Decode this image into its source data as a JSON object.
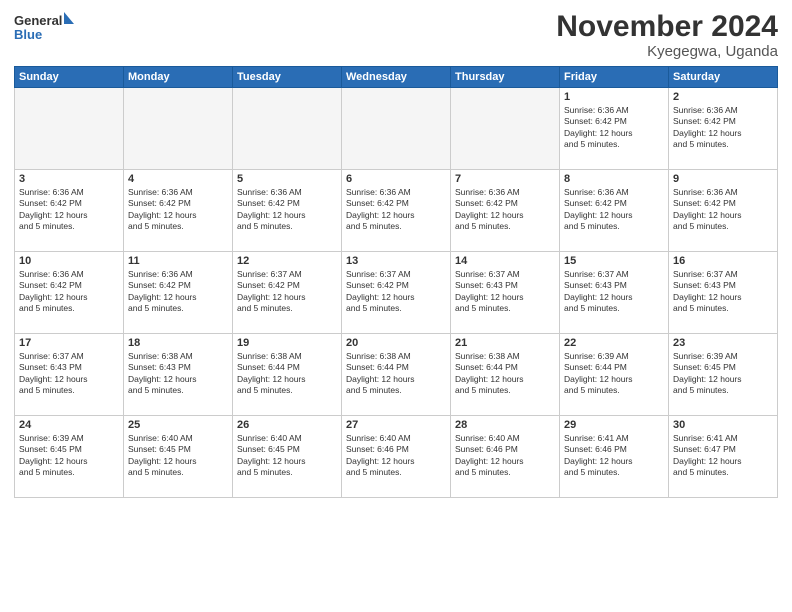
{
  "logo": {
    "general": "General",
    "blue": "Blue"
  },
  "title": "November 2024",
  "subtitle": "Kyegegwa, Uganda",
  "days_of_week": [
    "Sunday",
    "Monday",
    "Tuesday",
    "Wednesday",
    "Thursday",
    "Friday",
    "Saturday"
  ],
  "weeks": [
    [
      {
        "day": "",
        "info": ""
      },
      {
        "day": "",
        "info": ""
      },
      {
        "day": "",
        "info": ""
      },
      {
        "day": "",
        "info": ""
      },
      {
        "day": "",
        "info": ""
      },
      {
        "day": "1",
        "info": "Sunrise: 6:36 AM\nSunset: 6:42 PM\nDaylight: 12 hours\nand 5 minutes."
      },
      {
        "day": "2",
        "info": "Sunrise: 6:36 AM\nSunset: 6:42 PM\nDaylight: 12 hours\nand 5 minutes."
      }
    ],
    [
      {
        "day": "3",
        "info": "Sunrise: 6:36 AM\nSunset: 6:42 PM\nDaylight: 12 hours\nand 5 minutes."
      },
      {
        "day": "4",
        "info": "Sunrise: 6:36 AM\nSunset: 6:42 PM\nDaylight: 12 hours\nand 5 minutes."
      },
      {
        "day": "5",
        "info": "Sunrise: 6:36 AM\nSunset: 6:42 PM\nDaylight: 12 hours\nand 5 minutes."
      },
      {
        "day": "6",
        "info": "Sunrise: 6:36 AM\nSunset: 6:42 PM\nDaylight: 12 hours\nand 5 minutes."
      },
      {
        "day": "7",
        "info": "Sunrise: 6:36 AM\nSunset: 6:42 PM\nDaylight: 12 hours\nand 5 minutes."
      },
      {
        "day": "8",
        "info": "Sunrise: 6:36 AM\nSunset: 6:42 PM\nDaylight: 12 hours\nand 5 minutes."
      },
      {
        "day": "9",
        "info": "Sunrise: 6:36 AM\nSunset: 6:42 PM\nDaylight: 12 hours\nand 5 minutes."
      }
    ],
    [
      {
        "day": "10",
        "info": "Sunrise: 6:36 AM\nSunset: 6:42 PM\nDaylight: 12 hours\nand 5 minutes."
      },
      {
        "day": "11",
        "info": "Sunrise: 6:36 AM\nSunset: 6:42 PM\nDaylight: 12 hours\nand 5 minutes."
      },
      {
        "day": "12",
        "info": "Sunrise: 6:37 AM\nSunset: 6:42 PM\nDaylight: 12 hours\nand 5 minutes."
      },
      {
        "day": "13",
        "info": "Sunrise: 6:37 AM\nSunset: 6:42 PM\nDaylight: 12 hours\nand 5 minutes."
      },
      {
        "day": "14",
        "info": "Sunrise: 6:37 AM\nSunset: 6:43 PM\nDaylight: 12 hours\nand 5 minutes."
      },
      {
        "day": "15",
        "info": "Sunrise: 6:37 AM\nSunset: 6:43 PM\nDaylight: 12 hours\nand 5 minutes."
      },
      {
        "day": "16",
        "info": "Sunrise: 6:37 AM\nSunset: 6:43 PM\nDaylight: 12 hours\nand 5 minutes."
      }
    ],
    [
      {
        "day": "17",
        "info": "Sunrise: 6:37 AM\nSunset: 6:43 PM\nDaylight: 12 hours\nand 5 minutes."
      },
      {
        "day": "18",
        "info": "Sunrise: 6:38 AM\nSunset: 6:43 PM\nDaylight: 12 hours\nand 5 minutes."
      },
      {
        "day": "19",
        "info": "Sunrise: 6:38 AM\nSunset: 6:44 PM\nDaylight: 12 hours\nand 5 minutes."
      },
      {
        "day": "20",
        "info": "Sunrise: 6:38 AM\nSunset: 6:44 PM\nDaylight: 12 hours\nand 5 minutes."
      },
      {
        "day": "21",
        "info": "Sunrise: 6:38 AM\nSunset: 6:44 PM\nDaylight: 12 hours\nand 5 minutes."
      },
      {
        "day": "22",
        "info": "Sunrise: 6:39 AM\nSunset: 6:44 PM\nDaylight: 12 hours\nand 5 minutes."
      },
      {
        "day": "23",
        "info": "Sunrise: 6:39 AM\nSunset: 6:45 PM\nDaylight: 12 hours\nand 5 minutes."
      }
    ],
    [
      {
        "day": "24",
        "info": "Sunrise: 6:39 AM\nSunset: 6:45 PM\nDaylight: 12 hours\nand 5 minutes."
      },
      {
        "day": "25",
        "info": "Sunrise: 6:40 AM\nSunset: 6:45 PM\nDaylight: 12 hours\nand 5 minutes."
      },
      {
        "day": "26",
        "info": "Sunrise: 6:40 AM\nSunset: 6:45 PM\nDaylight: 12 hours\nand 5 minutes."
      },
      {
        "day": "27",
        "info": "Sunrise: 6:40 AM\nSunset: 6:46 PM\nDaylight: 12 hours\nand 5 minutes."
      },
      {
        "day": "28",
        "info": "Sunrise: 6:40 AM\nSunset: 6:46 PM\nDaylight: 12 hours\nand 5 minutes."
      },
      {
        "day": "29",
        "info": "Sunrise: 6:41 AM\nSunset: 6:46 PM\nDaylight: 12 hours\nand 5 minutes."
      },
      {
        "day": "30",
        "info": "Sunrise: 6:41 AM\nSunset: 6:47 PM\nDaylight: 12 hours\nand 5 minutes."
      }
    ]
  ]
}
